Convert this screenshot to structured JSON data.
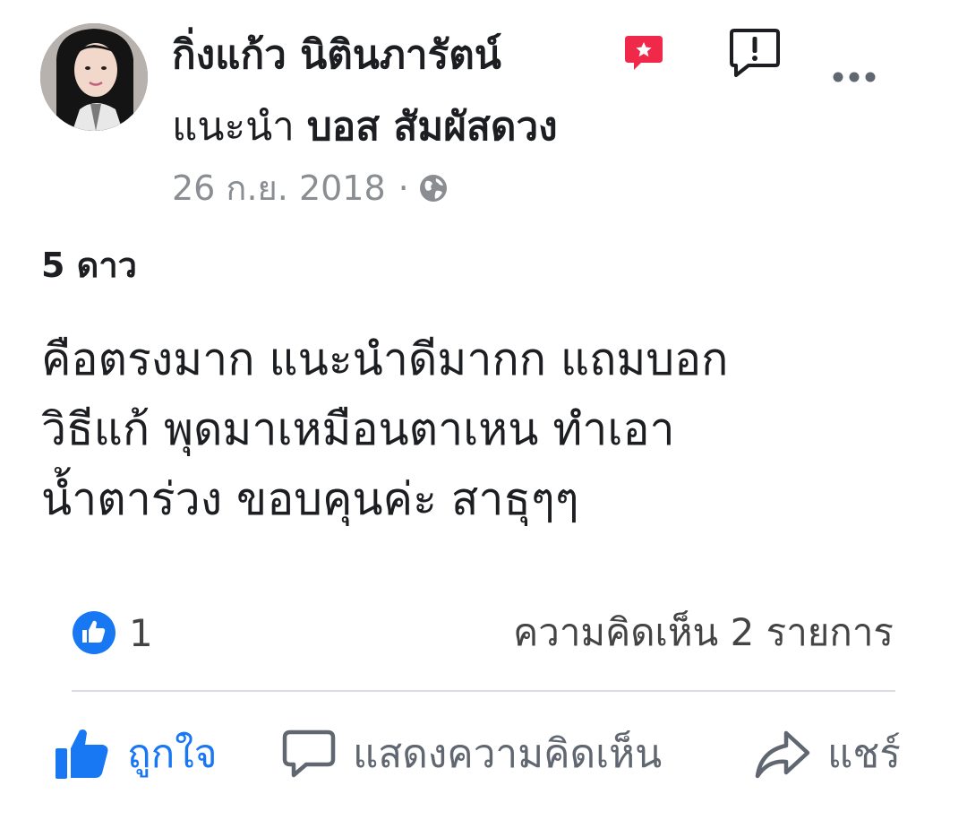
{
  "post": {
    "author_name": "กิ่งแก้ว นิตินภารัตน์",
    "recommends_label": "แนะนำ",
    "page_name": "บอส สัมผัสดวง",
    "date": "26 ก.ย. 2018",
    "separator": "·",
    "privacy_icon": "globe-icon",
    "rating_text": "5 ดาว",
    "body": "คือตรงมาก แนะนำดีมากก  แถมบอก\nวิธีแก้  พุดมาเหมือนตาเหน ทำเอา\nน้ำตาร่วง  ขอบคุนค่ะ  สาธุๆๆ"
  },
  "stats": {
    "likes": "1",
    "comments": "ความคิดเห็น 2 รายการ"
  },
  "actions": {
    "like_label": "ถูกใจ",
    "comment_label": "แสดงความคิดเห็น",
    "share_label": "แชร์"
  },
  "colors": {
    "brand_blue": "#1877f2",
    "badge_red": "#f02849",
    "text_primary": "#1c1e21",
    "text_secondary": "#8a8d91"
  }
}
